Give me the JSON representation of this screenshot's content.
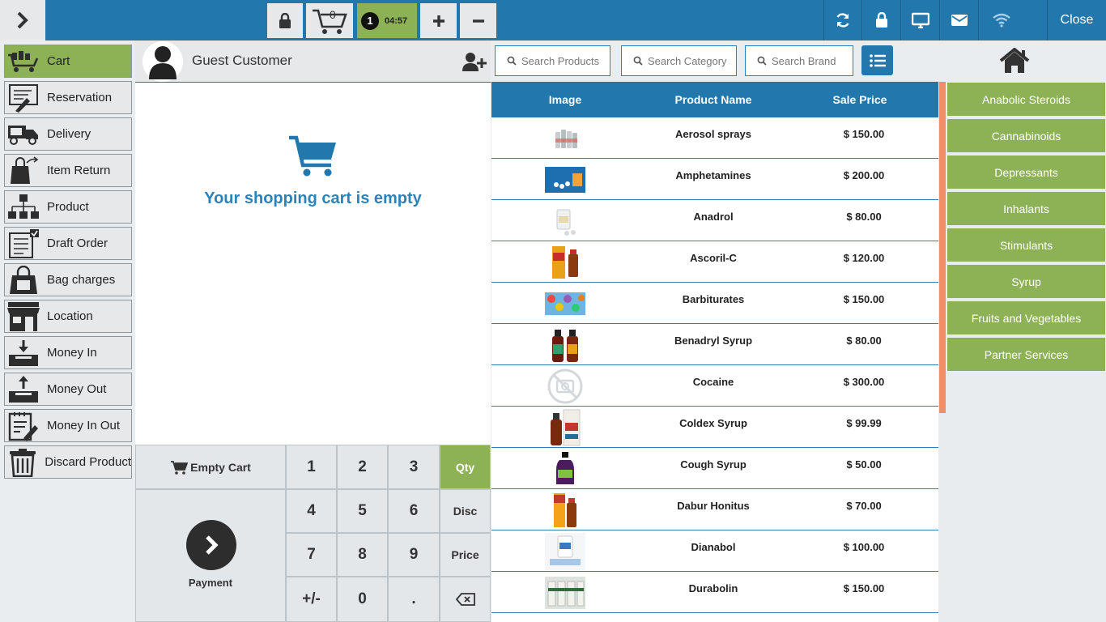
{
  "topbar": {
    "cart_count": "0",
    "timer_badge": "1",
    "timer_time": "04:57",
    "close_label": "Close",
    "colors": {
      "bar": "#2278ad",
      "timer_bg": "#8db155"
    }
  },
  "sidebar": {
    "items": [
      {
        "label": "Cart",
        "icon": "cart-icon"
      },
      {
        "label": "Reservation",
        "icon": "reservation-icon"
      },
      {
        "label": "Delivery",
        "icon": "truck-icon"
      },
      {
        "label": "Item Return",
        "icon": "return-bag-icon"
      },
      {
        "label": "Product",
        "icon": "product-hierarchy-icon"
      },
      {
        "label": "Draft Order",
        "icon": "draft-checklist-icon"
      },
      {
        "label": "Bag charges",
        "icon": "shopping-bag-icon"
      },
      {
        "label": "Location",
        "icon": "store-icon"
      },
      {
        "label": "Money In",
        "icon": "money-in-icon"
      },
      {
        "label": "Money Out",
        "icon": "money-out-icon"
      },
      {
        "label": "Money In Out",
        "icon": "money-in-out-icon"
      },
      {
        "label": "Discard Product",
        "icon": "trash-icon"
      }
    ]
  },
  "customer": {
    "name": "Guest Customer"
  },
  "cart": {
    "empty_message": "Your shopping cart is empty"
  },
  "keypad": {
    "empty_cart": "Empty Cart",
    "payment": "Payment",
    "keys": [
      "1",
      "2",
      "3",
      "Qty",
      "4",
      "5",
      "6",
      "Disc",
      "7",
      "8",
      "9",
      "Price",
      "+/-",
      "0",
      "."
    ]
  },
  "search": {
    "products": "Search Products",
    "category": "Search Category",
    "brand": "Search Brand"
  },
  "table": {
    "headers": [
      "Image",
      "Product Name",
      "Sale Price"
    ],
    "rows": [
      {
        "name": "Aerosol sprays",
        "price": "$ 150.00"
      },
      {
        "name": "Amphetamines",
        "price": "$ 200.00"
      },
      {
        "name": "Anadrol",
        "price": "$ 80.00"
      },
      {
        "name": "Ascoril-C",
        "price": "$ 120.00"
      },
      {
        "name": "Barbiturates",
        "price": "$ 150.00"
      },
      {
        "name": "Benadryl Syrup",
        "price": "$ 80.00"
      },
      {
        "name": "Cocaine",
        "price": "$ 300.00"
      },
      {
        "name": "Coldex Syrup",
        "price": "$ 99.99"
      },
      {
        "name": "Cough Syrup",
        "price": "$ 50.00"
      },
      {
        "name": "Dabur Honitus",
        "price": "$ 70.00"
      },
      {
        "name": "Dianabol",
        "price": "$ 100.00"
      },
      {
        "name": "Durabolin",
        "price": "$ 150.00"
      }
    ]
  },
  "categories": [
    "Anabolic Steroids",
    "Cannabinoids",
    "Depressants",
    "Inhalants",
    "Stimulants",
    "Syrup",
    "Fruits and Vegetables",
    "Partner Services"
  ]
}
